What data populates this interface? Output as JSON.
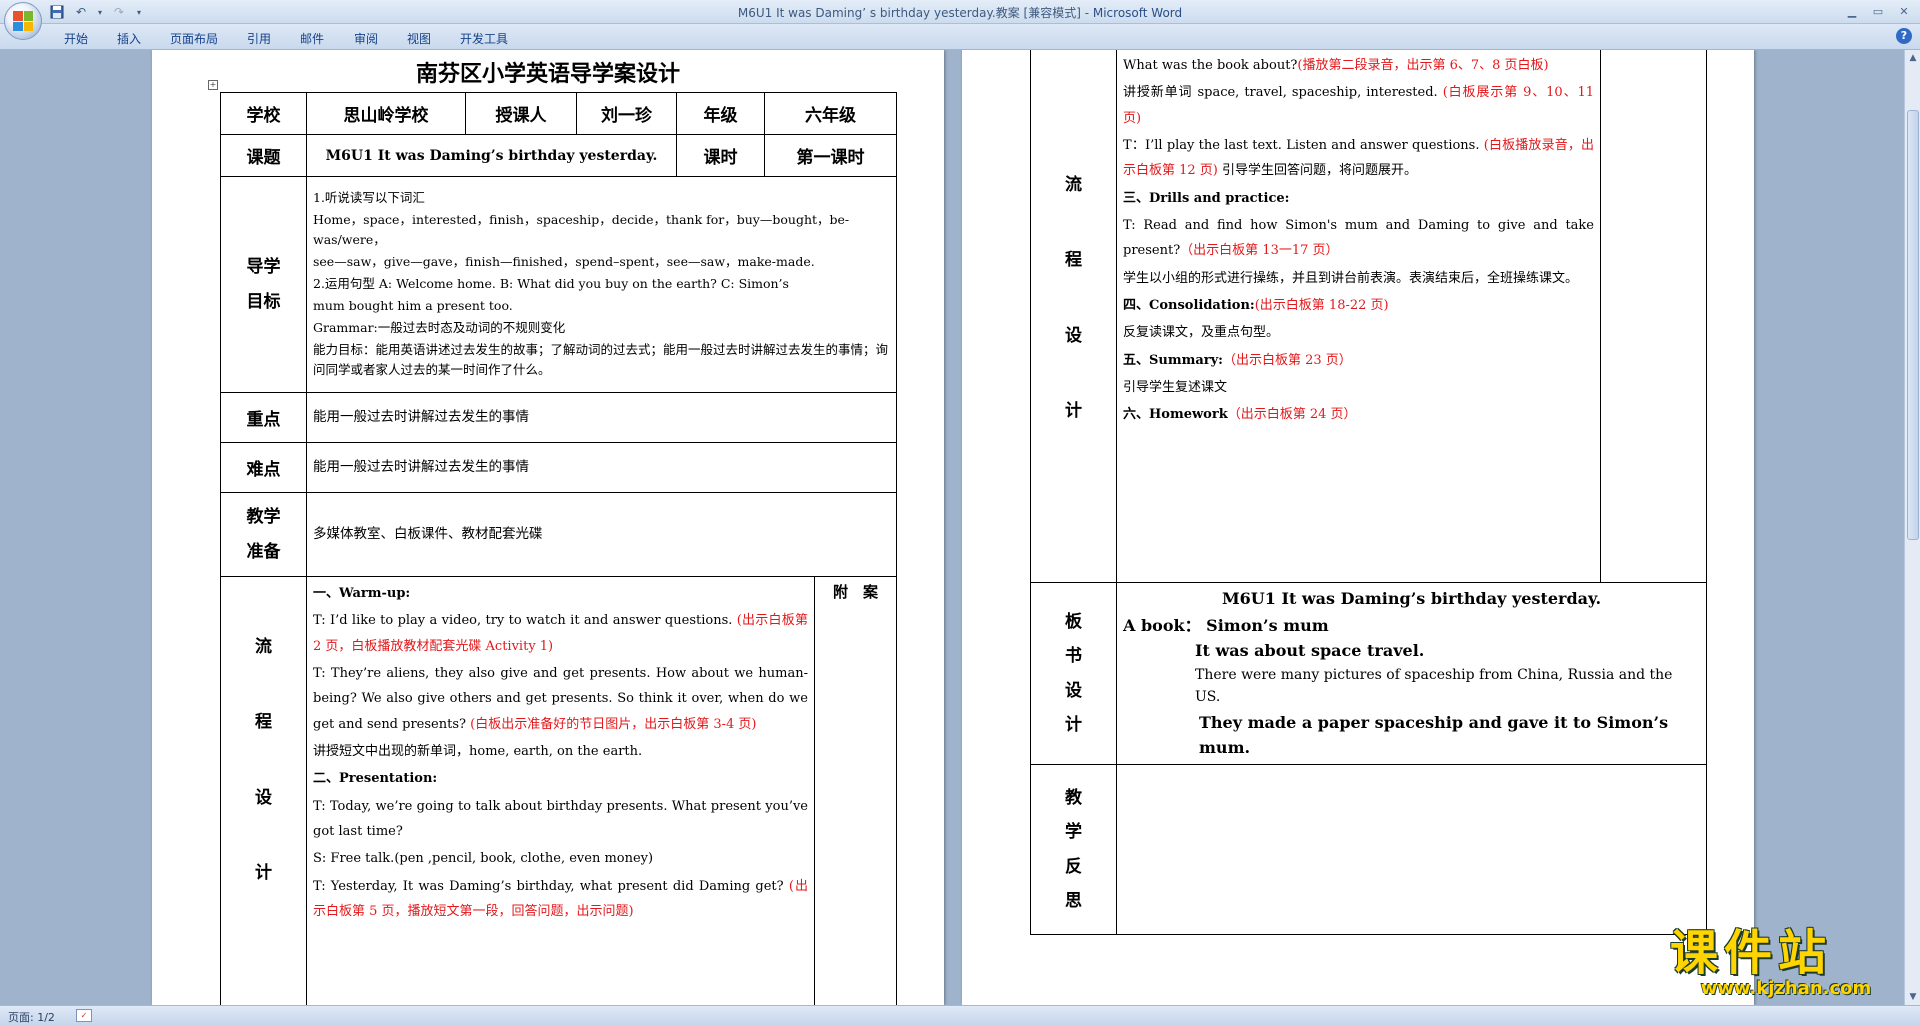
{
  "window": {
    "title": "M6U1 It was Daming’ s birthday yesterday.教案 [兼容模式]",
    "app_name": "Microsoft Word",
    "title_sep": " - "
  },
  "ribbon": {
    "tabs": [
      "开始",
      "插入",
      "页面布局",
      "引用",
      "邮件",
      "审阅",
      "视图",
      "开发工具"
    ]
  },
  "status": {
    "page_count": "页面: 1/2"
  },
  "watermark": {
    "cn": "课件站",
    "url": "www.kjzhan.com"
  },
  "doc": {
    "title": "南芬区小学英语导学案设计",
    "school_label": "学校",
    "school_value": "思山岭学校",
    "teacher_label": "授课人",
    "teacher_value": "刘一珍",
    "grade_label": "年级",
    "grade_value": "六年级",
    "topic_label": "课题",
    "topic_value": "M6U1 It was Daming’s birthday yesterday.",
    "period_label": "课时",
    "period_value": "第一课时",
    "goals_label_1": "导学",
    "goals_label_2": "目标",
    "goals": [
      "1.听说读写以下词汇",
      "Home，space，interested，finish，spaceship，decide，thank for，buy—bought，be-was/were，",
      "see—saw，give—gave，finish—finished，spend–spent，see—saw，make-made.",
      "2.运用句型 A: Welcome home. B: What did you buy on the earth? C: Simon’s",
      "mum bought him a present too.",
      "Grammar:一般过去时态及动词的不规则变化",
      "能力目标：能用英语讲述过去发生的故事；了解动词的过去式；能用一般过去时讲解过去发生的事情；询问同学或者家人过去的某一时间作了什么。"
    ],
    "key_label": "重点",
    "key_value": "能用一般过去时讲解过去发生的事情",
    "difficulty_label": "难点",
    "difficulty_value": "能用一般过去时讲解过去发生的事情",
    "prep_label_1": "教学",
    "prep_label_2": "准备",
    "prep_value": "多媒体教室、白板课件、教材配套光碟",
    "process_chars": [
      "流",
      "程",
      "设",
      "计"
    ],
    "appendix_label": "附　案",
    "p1": {
      "s1_head": "一、Warm-up:",
      "s1_t1": "T: I’d like to play a video, try to watch it and answer questions.",
      "s1_t1_red": "(出示白板第 2 页，白板播放教材配套光碟 Activity 1)",
      "s1_t2": "T: They’re aliens, they also give and get presents. How about we human-being? We also give others and get presents. So think it over, when do we get and send presents?",
      "s1_t2_red": "(白板出示准备好的节日图片，出示白板第 3-4 页)",
      "s1_t3": "讲授短文中出现的新单词，home, earth, on the earth.",
      "s2_head": "二、Presentation:",
      "s2_t1": "T: Today, we’re going to talk about birthday presents. What present you’ve got last time?",
      "s2_t2": "S: Free talk.(pen ,pencil, book, clothe, even money)",
      "s2_t3": "T: Yesterday, It was Daming’s birthday, what present did Daming get?",
      "s2_t3_red": "(出示白板第 5 页，播放短文第一段，回答问题，出示问题)"
    },
    "p2": {
      "l1": "What was the book about?",
      "l1_red": "(播放第二段录音，出示第 6、7、8 页白板)",
      "l2": "讲授新单词 space, travel, spaceship, interested.",
      "l2_red": "(白板展示第 9、10、11 页)",
      "l3": "T：I’ll play the last text. Listen and answer questions.",
      "l3_red": "(白板播放录音，出示白板第 12 页)",
      "l3_tail": "引导学生回答问题，将问题展开。",
      "s3_head": "三、Drills and practice:",
      "l4": "T: Read and find how Simon's mum and Daming to give and take present?",
      "l4_red": "（出示白板第 13一17 页）",
      "l5": "学生以小组的形式进行操练，并且到讲台前表演。表演结束后，全班操练课文。",
      "s4_head": "四、Consolidation:",
      "s4_red": "(出示白板第 18-22 页)",
      "l6": "反复读课文，及重点句型。",
      "s5_head": "五、Summary:",
      "s5_red": "（出示白板第 23 页）",
      "l7": "引导学生复述课文",
      "s6_head": "六、Homework",
      "s6_red": "（出示白板第 24 页）"
    },
    "board_chars": [
      "板",
      "书",
      "设",
      "计"
    ],
    "board": {
      "title": "M6U1 It was Daming’s birthday yesterday.",
      "line1": "A book： Simon’s mum",
      "line2": "It was about space travel.",
      "line3": "There were many pictures of spaceship from China, Russia and the US.",
      "line4": "They made a paper spaceship and gave it to Simon’s mum."
    },
    "reflect_chars": [
      "教",
      "学",
      "反",
      "思"
    ]
  }
}
